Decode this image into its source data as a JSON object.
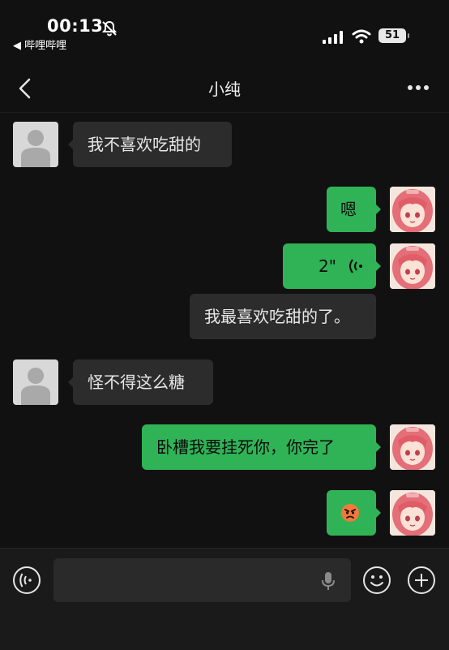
{
  "status_bar": {
    "time": "00:13",
    "back_app": "◀ 哔哩哔哩",
    "battery": "51"
  },
  "header": {
    "title": "小纯"
  },
  "messages": [
    {
      "side": "left",
      "text": "我不喜欢吃甜的"
    },
    {
      "side": "right",
      "text": "嗯"
    },
    {
      "side": "right",
      "type": "voice",
      "duration": "2\""
    },
    {
      "side": "left",
      "text": "我最喜欢吃甜的了。"
    },
    {
      "side": "left",
      "text": "怪不得这么糖"
    },
    {
      "side": "right",
      "text": "卧槽我要挂死你，你完了"
    },
    {
      "side": "right",
      "type": "emoji",
      "emoji": "angry-face"
    }
  ],
  "colors": {
    "background": "#111111",
    "incoming_bubble": "#2c2c2c",
    "outgoing_bubble": "#2fb356"
  }
}
